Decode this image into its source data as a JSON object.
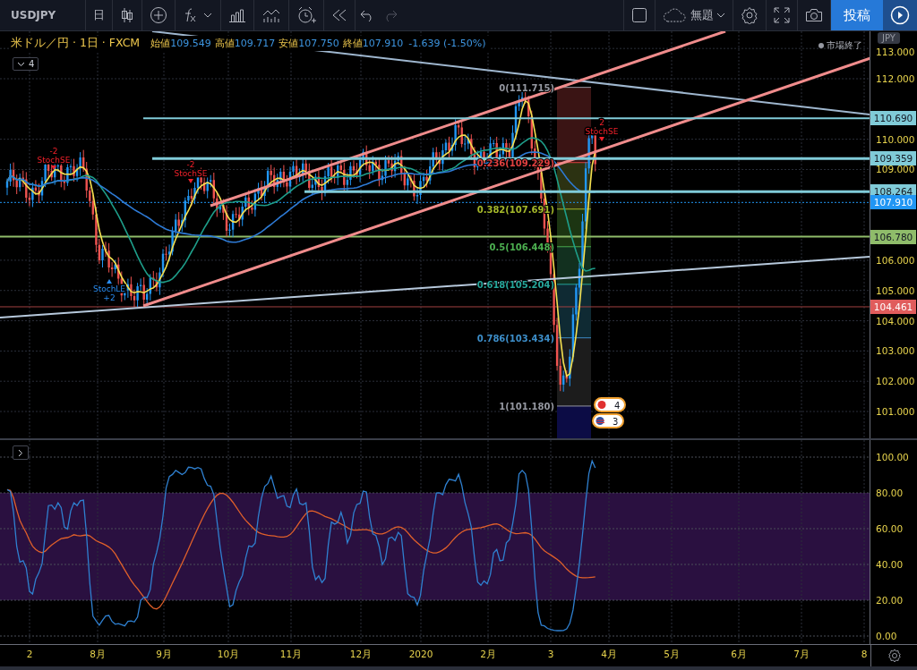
{
  "toolbar": {
    "symbol": "USDJPY",
    "interval": "日",
    "layout_name": "無題",
    "publish_button": "投稿",
    "undo_disabled": false,
    "redo_disabled": true
  },
  "legend": {
    "title": "米ドル／円 · 1日 · FXCM",
    "ohlc": [
      {
        "label": "始値",
        "value": "109.549"
      },
      {
        "label": "高値",
        "value": "109.717"
      },
      {
        "label": "安値",
        "value": "107.750"
      },
      {
        "label": "終値",
        "value": "107.910"
      }
    ],
    "change": "-1.639 (-1.50%)",
    "market_status": "市場終了",
    "indicator_count": "4"
  },
  "main_chart": {
    "fib_levels": [
      {
        "label": "0(111.715)",
        "color": "#9598a1"
      },
      {
        "label": "0.236(109.229)",
        "color": "#e04040"
      },
      {
        "label": "0.382(107.691)",
        "color": "#a5b82a"
      },
      {
        "label": "0.5(106.448)",
        "color": "#4caf50"
      },
      {
        "label": "0.618(105.204)",
        "color": "#26a69a"
      },
      {
        "label": "0.786(103.434)",
        "color": "#3d8ec9"
      },
      {
        "label": "1(101.180)",
        "color": "#9598a1"
      }
    ],
    "signals": [
      {
        "kind": "short",
        "count": "-2",
        "label": "StochSE"
      },
      {
        "kind": "short",
        "count": "-2",
        "label": "StochSE"
      },
      {
        "kind": "long",
        "count": "+2",
        "label": "StochLE"
      },
      {
        "kind": "short",
        "count": "2",
        "label": "StochSE"
      }
    ],
    "events": [
      {
        "kind": "jp",
        "count": "4"
      },
      {
        "kind": "us",
        "count": "3"
      }
    ]
  },
  "price_axis": {
    "currency": "JPY",
    "ticks": [
      "113.000",
      "112.000",
      "110.000",
      "109.000",
      "106.000",
      "105.000",
      "104.000",
      "103.000",
      "102.000",
      "101.000"
    ],
    "tags": [
      {
        "value": "110.690",
        "color": "#80cbd8"
      },
      {
        "value": "109.359",
        "color": "#80cbd8"
      },
      {
        "value": "108.264",
        "color": "#80cbd8"
      },
      {
        "value": "107.910",
        "color": "#2196f3"
      },
      {
        "value": "106.780",
        "color": "#8fbc6a"
      },
      {
        "value": "104.461",
        "color": "#e05c5c"
      }
    ]
  },
  "oscillator": {
    "ticks": [
      "100.00",
      "80.00",
      "60.00",
      "40.00",
      "20.00",
      "0.00"
    ]
  },
  "time_axis": {
    "labels": [
      "2",
      "8月",
      "9月",
      "10月",
      "11月",
      "12月",
      "2020",
      "2月",
      "3",
      "4月",
      "5月",
      "6月",
      "7月",
      "8"
    ]
  }
}
